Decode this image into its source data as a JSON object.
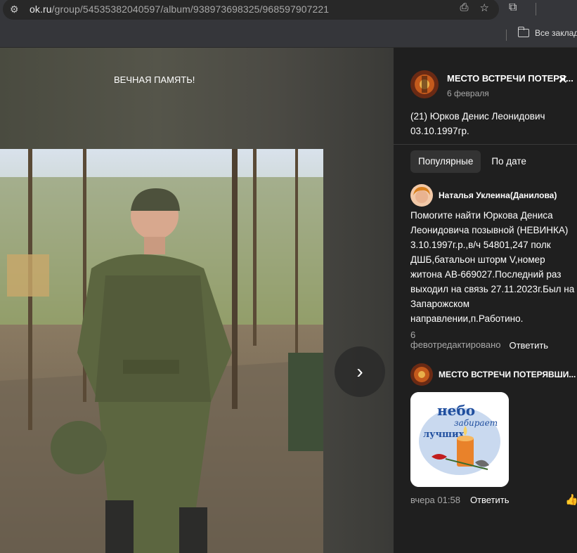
{
  "browser": {
    "url_host": "ok.ru",
    "url_path": "/group/54535382040597/album/938973698325/968597907221",
    "bookmarks_label": "Все заклад"
  },
  "photo": {
    "caption": "ВЕЧНАЯ ПАМЯТЬ!"
  },
  "post": {
    "author": "МЕСТО ВСТРЕЧИ ПОТЕРЯ...",
    "date": "6 февраля",
    "text": "(21) Юрков Денис Леонидович 03.10.1997гр."
  },
  "tabs": [
    {
      "label": "Популярные",
      "active": true
    },
    {
      "label": "По дате",
      "active": false
    }
  ],
  "comments": [
    {
      "author": "Наталья Уклеина(Данилова)",
      "text": "Помогите найти Юркова Дениса Леонидовича позывной (НЕВИНКА) 3.10.1997г.р.,в/ч 54801,247 полк ДШБ,батальон шторм V,номер житона АВ-669027.Последний раз выходил на связь 27.11.2023г.Был на Запарожском направлении,п.Работино.",
      "count": "6",
      "date": "февотредактировано",
      "reply": "Ответить"
    },
    {
      "author": "МЕСТО ВСТРЕЧИ ПОТЕРЯВШИ...",
      "sticker_line1": "небо",
      "sticker_line2": "забирает",
      "sticker_line3": "лучших",
      "date": "вчера 01:58",
      "reply": "Ответить"
    }
  ],
  "colors": {
    "panel_bg": "#1f1f1f",
    "tab_active": "#333333",
    "sticker_text": "#1f4e9e"
  }
}
